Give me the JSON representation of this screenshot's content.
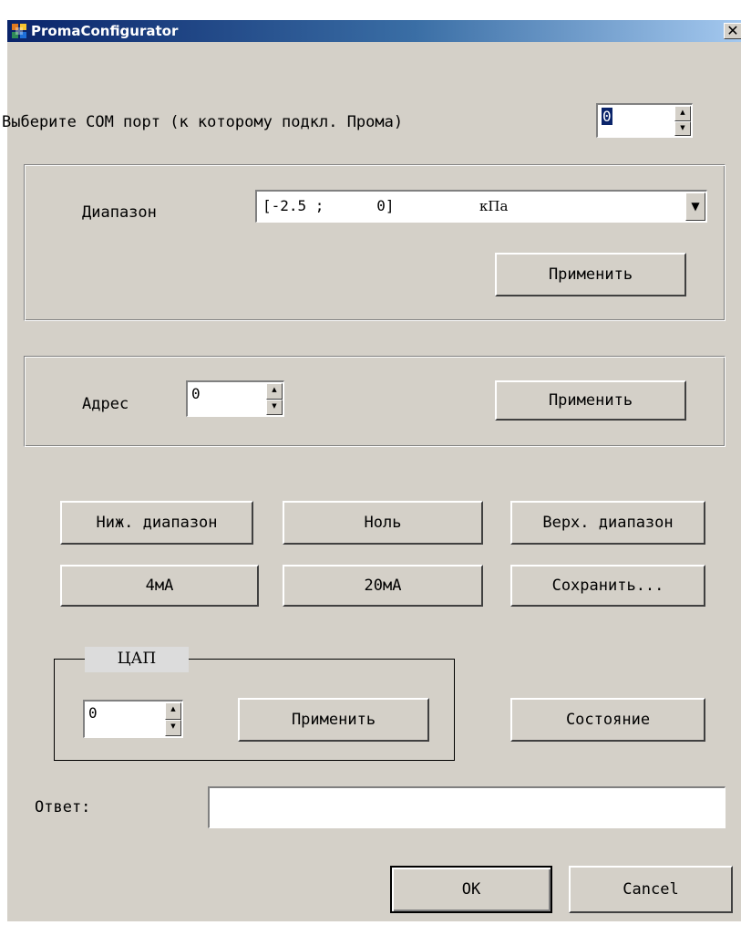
{
  "window": {
    "title": "PromaConfigurator",
    "close_glyph": "✕",
    "icon": "app-icon"
  },
  "com_port": {
    "label": "Выберите COM порт (к которому подкл. Прома)",
    "value": "0"
  },
  "range_group": {
    "label": "Диапазон",
    "selected_value": "[-2.5 ;      0]",
    "unit": "кПа",
    "apply_label": "Применить"
  },
  "address_group": {
    "label": "Адрес",
    "value": "0",
    "apply_label": "Применить"
  },
  "calibration": {
    "low_range": "Ниж. диапазон",
    "zero": "Ноль",
    "high_range": "Верх. диапазон",
    "ma4": "4мА",
    "ma20": "20мА",
    "save": "Сохранить..."
  },
  "dac_group": {
    "legend": "ЦАП",
    "value": "0",
    "apply_label": "Применить"
  },
  "status_button": "Состояние",
  "response": {
    "label": "Ответ:",
    "value": ""
  },
  "dialog_buttons": {
    "ok": "OK",
    "cancel": "Cancel"
  },
  "colors": {
    "face": "#d4d0c8",
    "title_start": "#0a246a",
    "title_end": "#a6caf0"
  }
}
